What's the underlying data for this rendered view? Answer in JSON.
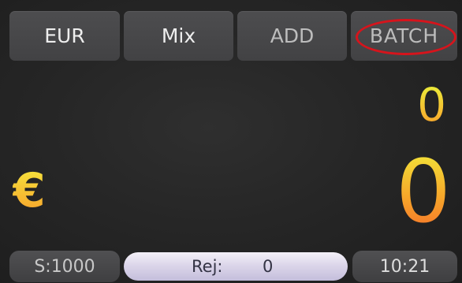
{
  "top_buttons": {
    "currency": "EUR",
    "mode": "Mix",
    "add": "ADD",
    "batch": "BATCH"
  },
  "display": {
    "batch_count": "0",
    "amount": "0",
    "currency_symbol": "€"
  },
  "status_bar": {
    "speed": "S:1000",
    "reject_label": "Rej:",
    "reject_value": "0",
    "time": "10:21"
  },
  "colors": {
    "highlight_ring": "#d6141c",
    "digit_gradient_top": "#f2e83a",
    "digit_gradient_bottom": "#f5702a",
    "button_bg": "#4a4a4c"
  }
}
